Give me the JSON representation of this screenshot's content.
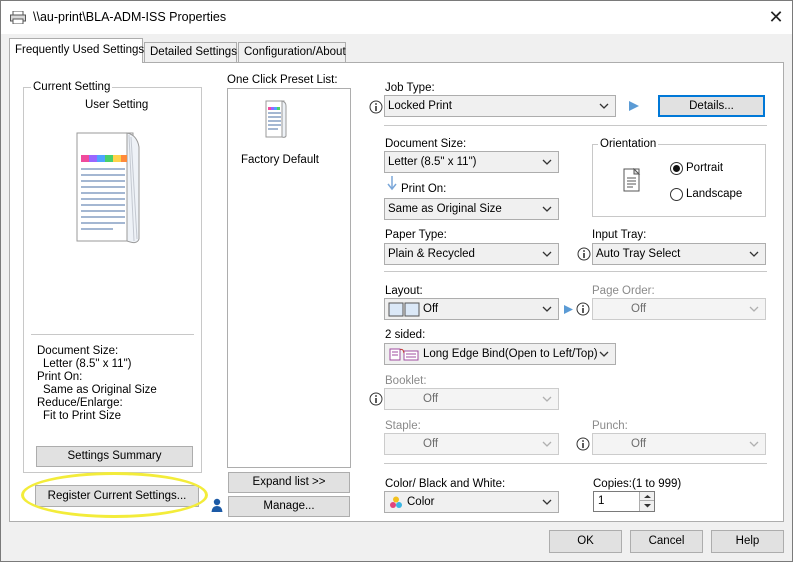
{
  "window": {
    "title": "\\\\au-print\\BLA-ADM-ISS Properties",
    "close_glyph": "✕"
  },
  "tabs": [
    {
      "label": "Frequently Used Settings",
      "active": true
    },
    {
      "label": "Detailed Settings",
      "active": false
    },
    {
      "label": "Configuration/About",
      "active": false
    }
  ],
  "current_setting": {
    "group_label": "Current Setting",
    "subtitle": "User Setting",
    "summary_lines": [
      "Document Size:",
      "Letter (8.5\" x 11\")",
      "Print On:",
      "Same as Original Size",
      "Reduce/Enlarge:",
      "Fit to Print Size"
    ],
    "settings_summary_button": "Settings Summary",
    "register_button": "Register Current Settings..."
  },
  "preset_list": {
    "label": "One Click Preset List:",
    "items": [
      "Factory Default"
    ],
    "expand_button": "Expand list >>",
    "manage_button": "Manage..."
  },
  "job_type": {
    "label": "Job Type:",
    "value": "Locked Print",
    "details_button": "Details..."
  },
  "document_size": {
    "label": "Document Size:",
    "value": "Letter (8.5\" x 11\")"
  },
  "print_on": {
    "label": "Print On:",
    "value": "Same as Original Size"
  },
  "orientation": {
    "label": "Orientation",
    "options": [
      {
        "label": "Portrait",
        "checked": true
      },
      {
        "label": "Landscape",
        "checked": false
      }
    ]
  },
  "paper_type": {
    "label": "Paper Type:",
    "value": "Plain & Recycled"
  },
  "input_tray": {
    "label": "Input Tray:",
    "value": "Auto Tray Select"
  },
  "layout": {
    "label": "Layout:",
    "value": "Off"
  },
  "page_order": {
    "label": "Page Order:",
    "value": "Off",
    "enabled": false
  },
  "two_sided": {
    "label": "2 sided:",
    "value": "Long Edge Bind(Open to Left/Top)"
  },
  "booklet": {
    "label": "Booklet:",
    "value": "Off",
    "enabled": false
  },
  "staple": {
    "label": "Staple:",
    "value": "Off",
    "enabled": false
  },
  "punch": {
    "label": "Punch:",
    "value": "Off",
    "enabled": false
  },
  "color_mode": {
    "label": "Color/ Black and White:",
    "value": "Color"
  },
  "copies": {
    "label": "Copies:(1 to 999)",
    "value": "1"
  },
  "footer": {
    "ok": "OK",
    "cancel": "Cancel",
    "help": "Help"
  },
  "colors": {
    "accent": "#0078d7",
    "highlight": "#f3ec3a",
    "info_icon": "#1c5aa6",
    "window_bg": "#f0f0f0",
    "panel_bg": "#ffffff"
  },
  "icons": {
    "title": "printer-icon",
    "info": "info-circle-icon",
    "play": "play-arrow-icon",
    "dropdown": "chevron-down-icon",
    "user": "person-icon"
  }
}
